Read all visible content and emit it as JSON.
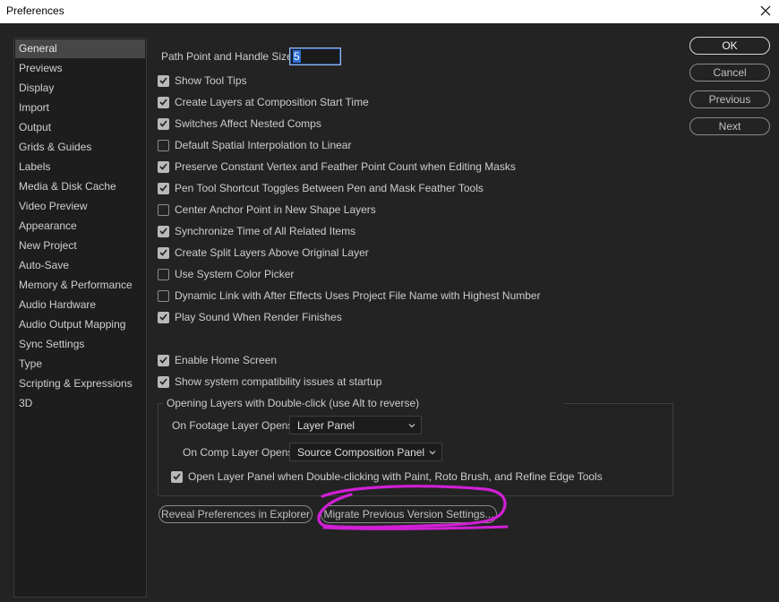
{
  "window": {
    "title": "Preferences"
  },
  "sidebar": {
    "items": [
      {
        "label": "General",
        "selected": true
      },
      {
        "label": "Previews"
      },
      {
        "label": "Display"
      },
      {
        "label": "Import"
      },
      {
        "label": "Output"
      },
      {
        "label": "Grids & Guides"
      },
      {
        "label": "Labels"
      },
      {
        "label": "Media & Disk Cache"
      },
      {
        "label": "Video Preview"
      },
      {
        "label": "Appearance"
      },
      {
        "label": "New Project"
      },
      {
        "label": "Auto-Save"
      },
      {
        "label": "Memory & Performance"
      },
      {
        "label": "Audio Hardware"
      },
      {
        "label": "Audio Output Mapping"
      },
      {
        "label": "Sync Settings"
      },
      {
        "label": "Type"
      },
      {
        "label": "Scripting & Expressions"
      },
      {
        "label": "3D"
      }
    ]
  },
  "general": {
    "path_point_label": "Path Point and Handle Size:",
    "path_point_value": "5",
    "checkboxes": [
      {
        "label": "Show Tool Tips",
        "checked": true
      },
      {
        "label": "Create Layers at Composition Start Time",
        "checked": true
      },
      {
        "label": "Switches Affect Nested Comps",
        "checked": true
      },
      {
        "label": "Default Spatial Interpolation to Linear",
        "checked": false
      },
      {
        "label": "Preserve Constant Vertex and Feather Point Count when Editing Masks",
        "checked": true
      },
      {
        "label": "Pen Tool Shortcut Toggles Between Pen and Mask Feather Tools",
        "checked": true
      },
      {
        "label": "Center Anchor Point in New Shape Layers",
        "checked": false
      },
      {
        "label": "Synchronize Time of All Related Items",
        "checked": true
      },
      {
        "label": "Create Split Layers Above Original Layer",
        "checked": true
      },
      {
        "label": "Use System Color Picker",
        "checked": false
      },
      {
        "label": "Dynamic Link with After Effects Uses Project File Name with Highest Number",
        "checked": false
      },
      {
        "label": "Play Sound When Render Finishes",
        "checked": true
      }
    ],
    "checkboxes2": [
      {
        "label": "Enable Home Screen",
        "checked": true
      },
      {
        "label": "Show system compatibility issues at startup",
        "checked": true
      }
    ],
    "double_click_group": {
      "legend": "Opening Layers with Double-click (use Alt to reverse)",
      "footage_label": "On Footage Layer Opens:",
      "footage_value": "Layer Panel",
      "comp_label": "On Comp Layer Opens:",
      "comp_value": "Source Composition Panel",
      "open_panel_label": "Open Layer Panel when Double-clicking with Paint, Roto Brush, and Refine Edge Tools",
      "open_panel_checked": true
    },
    "reveal_button": "Reveal Preferences in Explorer",
    "migrate_button": "Migrate Previous Version Settings..."
  },
  "buttons": {
    "ok": "OK",
    "cancel": "Cancel",
    "previous": "Previous",
    "next": "Next"
  },
  "colors": {
    "background": "#232323",
    "annotation": "#d11fd6"
  }
}
